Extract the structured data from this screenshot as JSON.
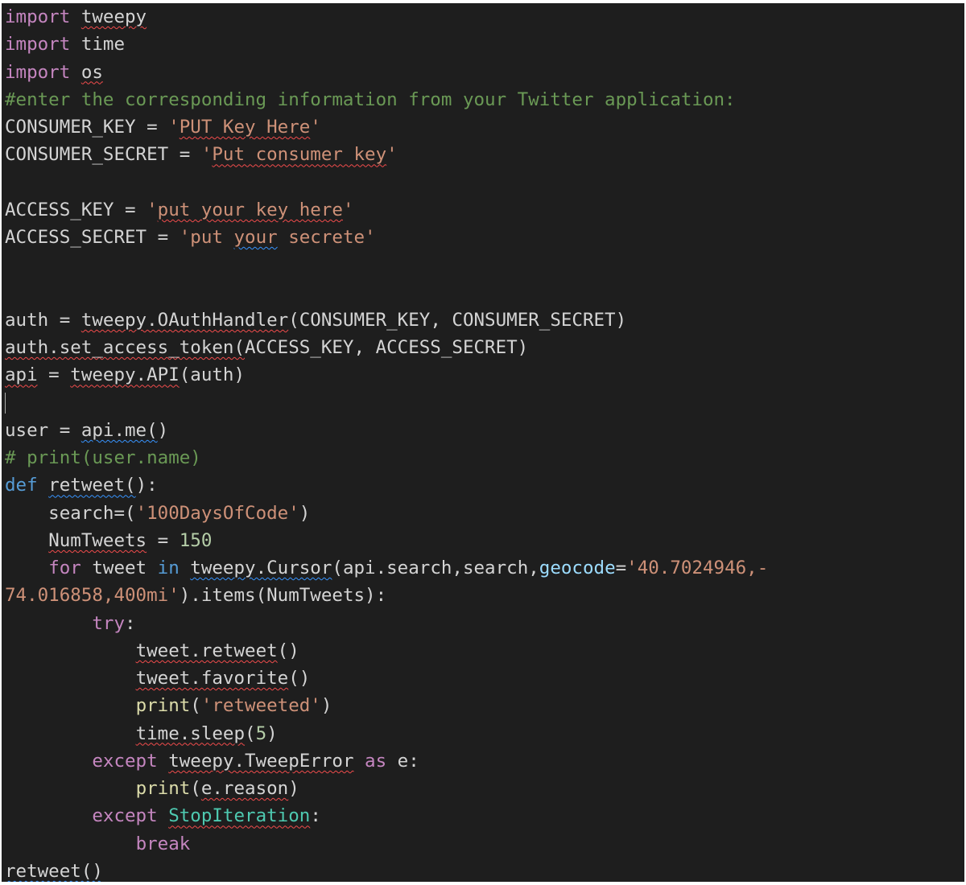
{
  "editor": {
    "background": "#1e1e1e",
    "colors": {
      "keyword_import": "#c586c0",
      "keyword_def": "#569cd6",
      "string": "#ce9178",
      "number": "#b5cea8",
      "comment": "#6a9955",
      "function": "#dcdcaa",
      "parameter": "#9cdcfe",
      "class": "#4ec9b0",
      "default": "#d4d4d4",
      "spellcheck_red": "#f14c4c",
      "spellcheck_blue": "#3794ff"
    },
    "lines": [
      [
        {
          "t": "import",
          "c": "kw-import"
        },
        {
          "t": " "
        },
        {
          "t": "tweepy",
          "s": "red"
        }
      ],
      [
        {
          "t": "import",
          "c": "kw-import"
        },
        {
          "t": " time"
        }
      ],
      [
        {
          "t": "import",
          "c": "kw-import"
        },
        {
          "t": " "
        },
        {
          "t": "os",
          "s": "red"
        }
      ],
      [
        {
          "t": "#enter the corresponding information from your Twitter application:",
          "c": "comment"
        }
      ],
      [
        {
          "t": "CONSUMER_KEY = "
        },
        {
          "t": "'",
          "c": "str"
        },
        {
          "t": "PUT Key Here",
          "c": "str",
          "s": "red"
        },
        {
          "t": "'",
          "c": "str"
        }
      ],
      [
        {
          "t": "CONSUMER_SECRET = "
        },
        {
          "t": "'",
          "c": "str"
        },
        {
          "t": "Put consumer key",
          "c": "str",
          "s": "red"
        },
        {
          "t": "'",
          "c": "str"
        }
      ],
      [],
      [
        {
          "t": "ACCESS_KEY = "
        },
        {
          "t": "'",
          "c": "str"
        },
        {
          "t": "put your key here",
          "c": "str",
          "s": "red"
        },
        {
          "t": "'",
          "c": "str"
        }
      ],
      [
        {
          "t": "ACCESS_SECRET = "
        },
        {
          "t": "'put ",
          "c": "str"
        },
        {
          "t": "your",
          "c": "str",
          "s": "blue"
        },
        {
          "t": " secrete'",
          "c": "str"
        }
      ],
      [],
      [],
      [
        {
          "t": "auth = "
        },
        {
          "t": "tweepy.OAuthHandler",
          "s": "red"
        },
        {
          "t": "(CONSUMER_KEY, CONSUMER_SECRET)"
        }
      ],
      [
        {
          "t": "auth.set_access_token(",
          "s": "red"
        },
        {
          "t": "ACCESS_KEY, ACCESS_SECRET)"
        }
      ],
      [
        {
          "t": "api",
          "s": "red"
        },
        {
          "t": " = "
        },
        {
          "t": "tweepy.API",
          "s": "red"
        },
        {
          "t": "(auth)"
        }
      ],
      [
        {
          "caret": true
        }
      ],
      [
        {
          "t": "user = "
        },
        {
          "t": "api.me(",
          "s": "blue"
        },
        {
          "t": ")"
        }
      ],
      [
        {
          "t": "# print(user.name)",
          "c": "comment"
        }
      ],
      [
        {
          "t": "def",
          "c": "kw-def"
        },
        {
          "t": " "
        },
        {
          "t": "retweet(",
          "s": "blue"
        },
        {
          "t": "):"
        }
      ],
      [
        {
          "t": "    search=("
        },
        {
          "t": "'100DaysOfCode'",
          "c": "str"
        },
        {
          "t": ")"
        }
      ],
      [
        {
          "t": "    "
        },
        {
          "t": "NumTweets",
          "s": "red"
        },
        {
          "t": " = "
        },
        {
          "t": "150",
          "c": "num"
        }
      ],
      [
        {
          "t": "    "
        },
        {
          "t": "for",
          "c": "kw-ctrl"
        },
        {
          "t": " tweet "
        },
        {
          "t": "in",
          "c": "kw-in"
        },
        {
          "t": " "
        },
        {
          "t": "tweepy.Cursor",
          "s": "blue"
        },
        {
          "t": "(api.search,search,"
        },
        {
          "t": "geocode",
          "c": "param"
        },
        {
          "t": "="
        },
        {
          "t": "'40.7024946,-",
          "c": "str"
        }
      ],
      [
        {
          "t": "74.016858,400mi'",
          "c": "str"
        },
        {
          "t": ").items(NumTweets):"
        }
      ],
      [
        {
          "t": "        "
        },
        {
          "t": "try",
          "c": "kw-ctrl"
        },
        {
          "t": ":"
        }
      ],
      [
        {
          "t": "            "
        },
        {
          "t": "tweet.retweet",
          "s": "red"
        },
        {
          "t": "()"
        }
      ],
      [
        {
          "t": "            "
        },
        {
          "t": "tweet.favorite",
          "s": "red"
        },
        {
          "t": "()"
        }
      ],
      [
        {
          "t": "            "
        },
        {
          "t": "print",
          "c": "func"
        },
        {
          "t": "("
        },
        {
          "t": "'retweeted'",
          "c": "str"
        },
        {
          "t": ")"
        }
      ],
      [
        {
          "t": "            "
        },
        {
          "t": "time.sleep",
          "s": "red"
        },
        {
          "t": "("
        },
        {
          "t": "5",
          "c": "num"
        },
        {
          "t": ")"
        }
      ],
      [
        {
          "t": "        "
        },
        {
          "t": "except",
          "c": "kw-ctrl"
        },
        {
          "t": " "
        },
        {
          "t": "tweepy.TweepError",
          "s": "red"
        },
        {
          "t": " "
        },
        {
          "t": "as",
          "c": "kw-ctrl"
        },
        {
          "t": " e:"
        }
      ],
      [
        {
          "t": "            "
        },
        {
          "t": "print",
          "c": "func"
        },
        {
          "t": "("
        },
        {
          "t": "e.reason",
          "s": "red"
        },
        {
          "t": ")"
        }
      ],
      [
        {
          "t": "        "
        },
        {
          "t": "except",
          "c": "kw-ctrl"
        },
        {
          "t": " "
        },
        {
          "t": "StopIteration",
          "c": "cls",
          "s": "red"
        },
        {
          "t": ":"
        }
      ],
      [
        {
          "t": "            "
        },
        {
          "t": "break",
          "c": "kw-ctrl"
        }
      ],
      [
        {
          "t": "retweet()",
          "s": "blue"
        }
      ]
    ]
  }
}
